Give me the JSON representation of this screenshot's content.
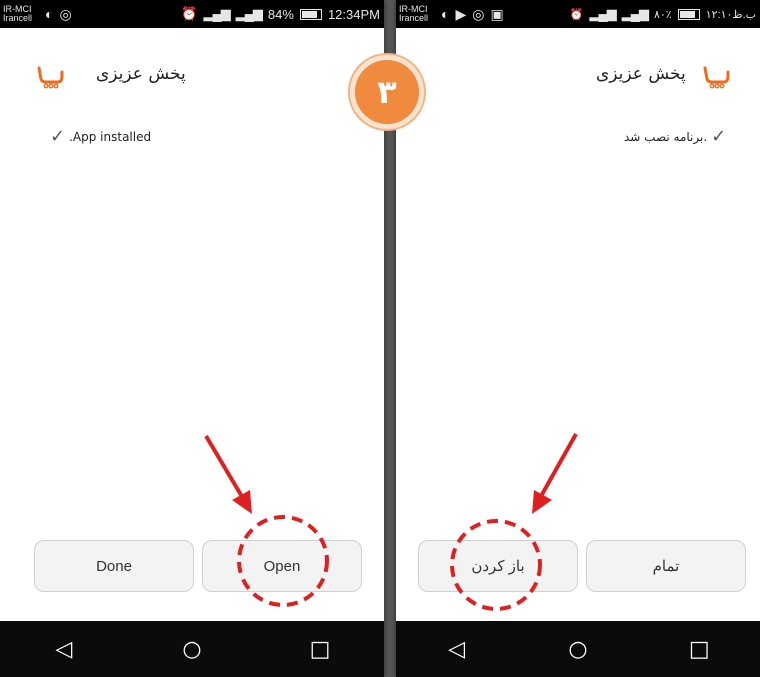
{
  "left": {
    "status": {
      "carrier_line1": "IR-MCI",
      "carrier_line2": "Irancell",
      "battery": "84%",
      "time": "12:34PM"
    },
    "app_title": "پخش عزیزی",
    "message": ".App installed",
    "buttons": {
      "done": "Done",
      "open": "Open"
    }
  },
  "right": {
    "status": {
      "carrier_line1": "IR-MCI",
      "carrier_line2": "Irancell",
      "battery": "۸۰٪",
      "time": "۱۲:۱۰ب.ظ"
    },
    "app_title": "پخش عزیزی",
    "message": "برنامه نصب شد.",
    "buttons": {
      "open": "باز کردن",
      "done": "تمام"
    }
  },
  "step_badge": "۳",
  "icons": {
    "check": "check-icon",
    "back": "back-triangle-icon",
    "home": "home-circle-icon",
    "recents": "recents-square-icon"
  },
  "colors": {
    "logo": "#f26b1d",
    "badge": "#f08a3e",
    "annotation": "#e02020"
  }
}
